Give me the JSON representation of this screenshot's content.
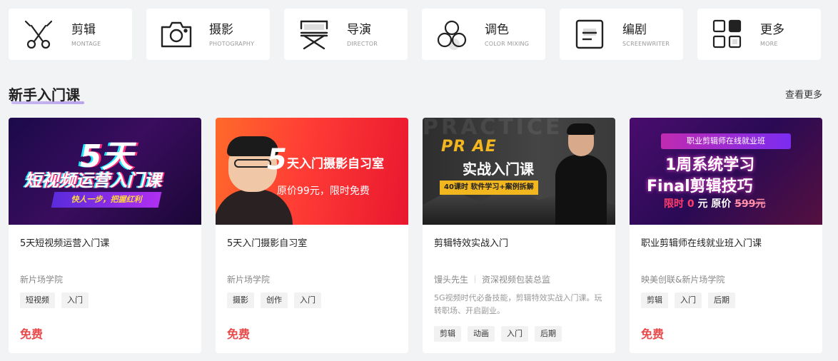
{
  "categories": [
    {
      "zh": "剪辑",
      "en": "MONTAGE",
      "icon": "scissors-icon"
    },
    {
      "zh": "摄影",
      "en": "PHOTOGRAPHY",
      "icon": "camera-icon"
    },
    {
      "zh": "导演",
      "en": "DIRECTOR",
      "icon": "director-chair-icon"
    },
    {
      "zh": "调色",
      "en": "COLOR MIXING",
      "icon": "color-circles-icon"
    },
    {
      "zh": "编剧",
      "en": "SCREENWRITER",
      "icon": "script-icon"
    },
    {
      "zh": "更多",
      "en": "MORE",
      "icon": "grid-more-icon"
    }
  ],
  "section": {
    "title": "新手入门课",
    "see_more": "查看更多"
  },
  "courses": [
    {
      "title": "5天短视频运营入门课",
      "author": "新片场学院",
      "tags": [
        "短视频",
        "入门"
      ],
      "price": "免费",
      "thumb": {
        "line1": "5天",
        "line2": "短视频运营入门课",
        "line3": "快人一步，把握红利"
      }
    },
    {
      "title": "5天入门摄影自习室",
      "author": "新片场学院",
      "tags": [
        "摄影",
        "创作",
        "入门"
      ],
      "price": "免费",
      "thumb": {
        "line1": "5",
        "line2": "天入门摄影自习室",
        "line3": "原价99元，限时免费"
      }
    },
    {
      "title": "剪辑特效实战入门",
      "author": "馒头先生",
      "author_role": "资深视频包装总监",
      "desc": "5G视频时代必备技能，剪辑特效实战入门课。玩转职场、开启副业。",
      "tags": [
        "剪辑",
        "动画",
        "入门",
        "后期"
      ],
      "thumb": {
        "bg": "PRACTICE",
        "line1": "PR AE",
        "line2": "实战入门课",
        "line3": "40课时 软件学习+案例拆解"
      }
    },
    {
      "title": "职业剪辑师在线就业班入门课",
      "author": "映美创联&新片场学院",
      "tags": [
        "剪辑",
        "入门",
        "后期"
      ],
      "price": "免费",
      "thumb": {
        "line1": "职业剪辑师在线就业班",
        "line2": "1周系统学习",
        "line3": "Final剪辑技巧",
        "price_a": "限时",
        "price_b": "0",
        "price_c": "元",
        "price_d": "原价",
        "price_e": "599元"
      }
    }
  ]
}
